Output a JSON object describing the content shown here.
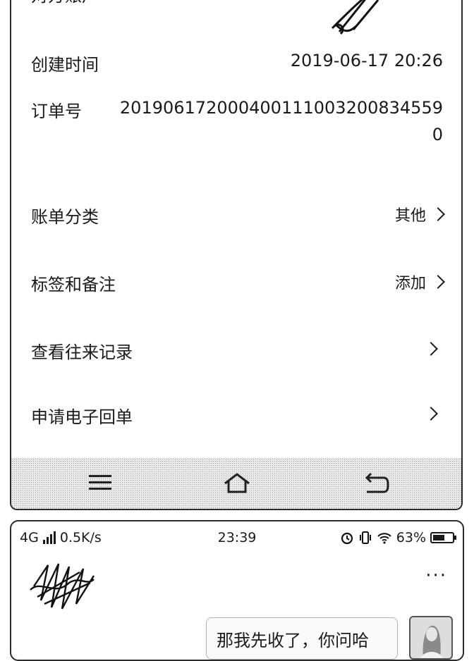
{
  "bill_detail": {
    "counterparty_label": "对方账户",
    "created_label": "创建时间",
    "created_value": "2019-06-17 20:26",
    "order_label": "订单号",
    "order_value": "2019061720004001110032008345590",
    "category_label": "账单分类",
    "category_value": "其他",
    "tags_label": "标签和备注",
    "tags_value": "添加",
    "history_label": "查看往来记录",
    "receipt_label": "申请电子回单"
  },
  "nav": {
    "icons": [
      "menu-icon",
      "home-icon",
      "back-icon"
    ]
  },
  "chat_screen": {
    "status": {
      "network": "4G",
      "speed": "0.5K/s",
      "time": "23:39",
      "battery": "63%",
      "battery_level": 0.63
    },
    "more_label": "···",
    "message": "那我先收了，你问哈"
  }
}
